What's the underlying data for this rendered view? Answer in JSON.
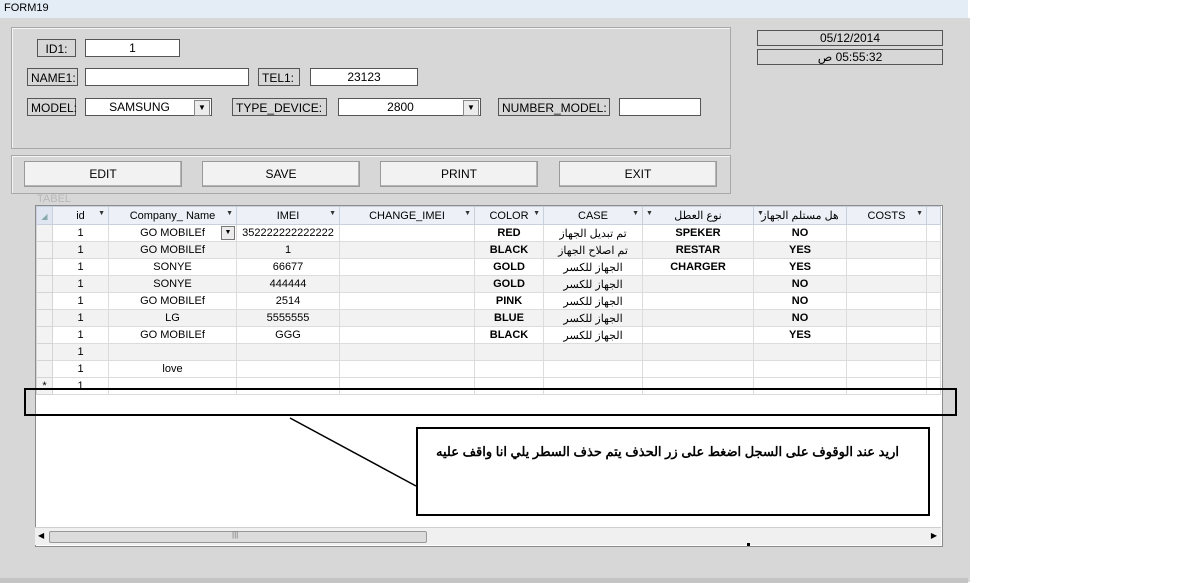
{
  "window": {
    "title": "FORM19"
  },
  "form": {
    "id_label": "ID1:",
    "id_value": "1",
    "name_label": "NAME1:",
    "name_value": "",
    "tel_label": "TEL1:",
    "tel_value": "23123",
    "model_label": "MODEL:",
    "model_value": "SAMSUNG",
    "type_label": "TYPE_DEVICE:",
    "type_value": "2800",
    "number_label": "NUMBER_MODEL:",
    "number_value": ""
  },
  "clock": {
    "date": "05/12/2014",
    "time": "05:55:32 ص"
  },
  "buttons": {
    "edit": "EDIT",
    "save": "SAVE",
    "print": "PRINT",
    "exit": "EXIT"
  },
  "table": {
    "caption": "TABEL",
    "columns": [
      "id",
      "Company_ Name",
      "IMEI",
      "CHANGE_IMEI",
      "COLOR",
      "CASE",
      "نوع العطل",
      "هل مستلم الجهاز",
      "COSTS"
    ],
    "rows": [
      [
        "1",
        "GO MOBILEf",
        "352222222222222",
        "",
        "RED",
        "تم تبديل الجهاز",
        "SPEKER",
        "NO",
        ""
      ],
      [
        "1",
        "GO MOBILEf",
        "1",
        "",
        "BLACK",
        "تم اصلاح الجهاز",
        "RESTAR",
        "YES",
        ""
      ],
      [
        "1",
        "SONYE",
        "66677",
        "",
        "GOLD",
        "الجهاز للكسر",
        "CHARGER",
        "YES",
        ""
      ],
      [
        "1",
        "SONYE",
        "444444",
        "",
        "GOLD",
        "الجهاز للكسر",
        "",
        "NO",
        ""
      ],
      [
        "1",
        "GO MOBILEf",
        "2514",
        "",
        "PINK",
        "الجهاز للكسر",
        "",
        "NO",
        ""
      ],
      [
        "1",
        "LG",
        "5555555",
        "",
        "BLUE",
        "الجهاز للكسر",
        "",
        "NO",
        ""
      ],
      [
        "1",
        "GO MOBILEf",
        "GGG",
        "",
        "BLACK",
        "الجهاز للكسر",
        "",
        "YES",
        ""
      ],
      [
        "1",
        "",
        "",
        "",
        "",
        "",
        "",
        "",
        ""
      ],
      [
        "1",
        "love",
        "",
        "",
        "",
        "",
        "",
        "",
        ""
      ]
    ],
    "new_row": {
      "marker": "*",
      "id": "1"
    }
  },
  "note": {
    "text": "اريد عند الوقوف على السجل اضغط على زر الحذف  يتم حذف السطر يلي انا واقف عليه"
  },
  "icons": {
    "dropdown": "chevron-down-icon",
    "record_selector": "record-selector-icon",
    "new_record": "asterisk-icon"
  }
}
